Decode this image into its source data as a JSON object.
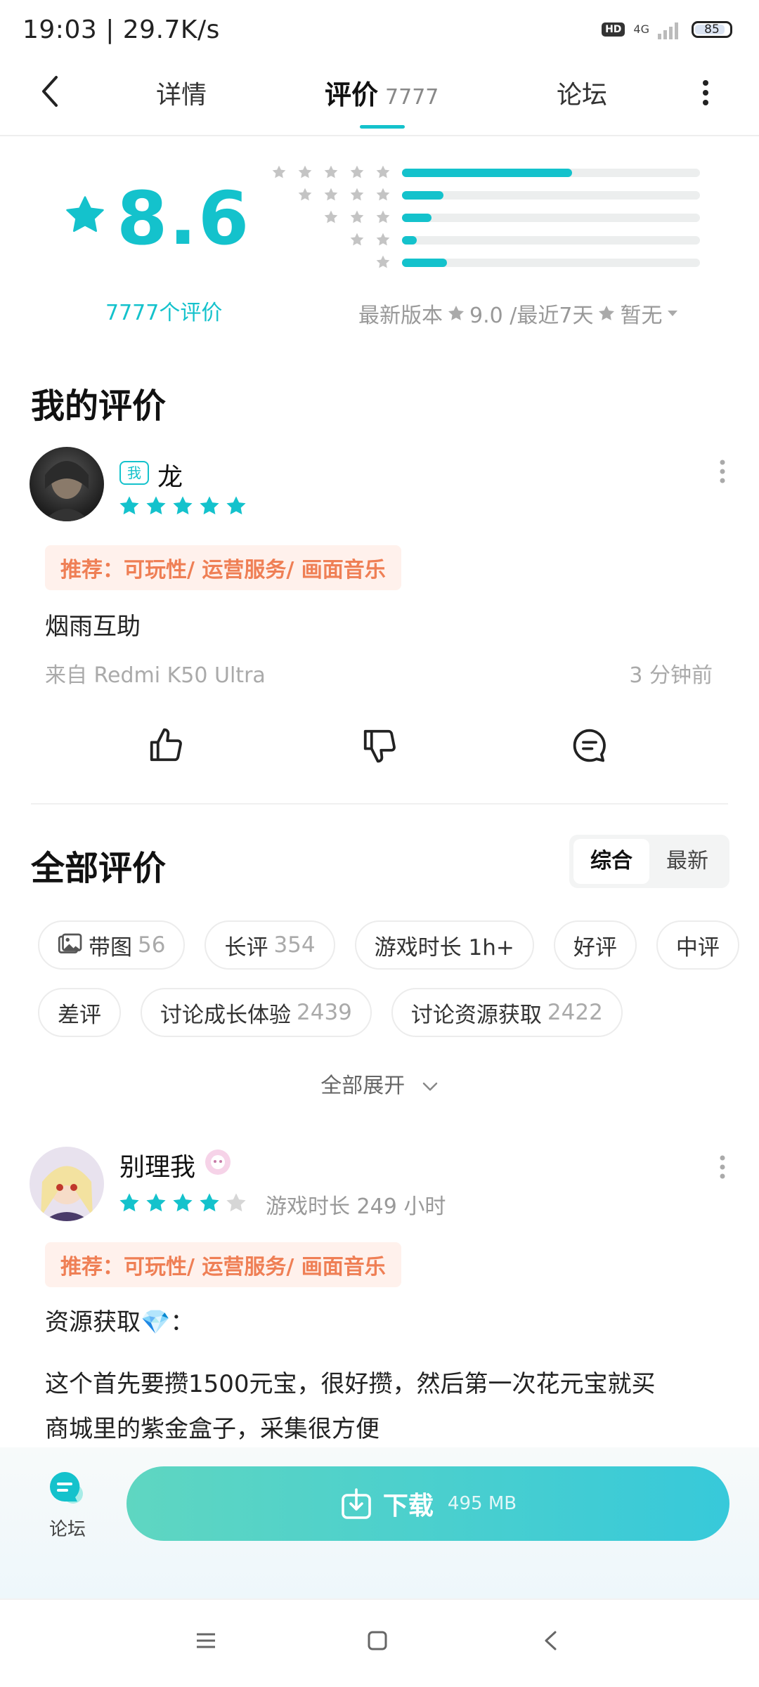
{
  "status_bar": {
    "time": "19:03 | 29.7K/s",
    "hd": "HD",
    "network": "4G",
    "battery": "85"
  },
  "tabs": {
    "details": "详情",
    "reviews": "评价",
    "reviews_count": "7777",
    "forum": "论坛"
  },
  "rating": {
    "score": "8.6",
    "count_text": "7777个评价",
    "distribution": [
      {
        "stars": 5,
        "fraction": 0.57
      },
      {
        "stars": 4,
        "fraction": 0.14
      },
      {
        "stars": 3,
        "fraction": 0.1
      },
      {
        "stars": 2,
        "fraction": 0.05
      },
      {
        "stars": 1,
        "fraction": 0.15
      }
    ],
    "latest_version_label": "最新版本",
    "latest_version_score": "9.0 /最近7天",
    "recent_score": "暂无"
  },
  "my_review": {
    "section_title": "我的评价",
    "me_badge": "我",
    "username": "龙",
    "stars": 5,
    "tag": "推荐：可玩性/ 运营服务/ 画面音乐",
    "content": "烟雨互助",
    "device": "来自 Redmi K50 Ultra",
    "time": "3 分钟前"
  },
  "all_reviews": {
    "section_title": "全部评价",
    "sort_options": [
      "综合",
      "最新"
    ],
    "filters_row1": [
      {
        "label": "带图",
        "count": "56",
        "icon": "image-icon"
      },
      {
        "label": "长评",
        "count": "354"
      },
      {
        "label": "游戏时长 1h+",
        "count": ""
      },
      {
        "label": "好评",
        "count": ""
      },
      {
        "label": "中评",
        "count": ""
      }
    ],
    "filters_row2": [
      {
        "label": "差评",
        "count": ""
      },
      {
        "label": "讨论成长体验",
        "count": "2439"
      },
      {
        "label": "讨论资源获取",
        "count": "2422"
      }
    ],
    "expand_label": "全部展开"
  },
  "review_item": {
    "username": "别理我",
    "stars": 4,
    "playtime": "游戏时长 249 小时",
    "tag": "推荐：可玩性/ 运营服务/ 画面音乐",
    "heading": "资源获取💎：",
    "content_line1": "这个首先要攒1500元宝，很好攒，然后第一次花元宝就买",
    "content_line2": "商城里的紫金盒子，采集很方便"
  },
  "bottom": {
    "forum_label": "论坛",
    "download_label": "下载",
    "download_size": "495 MB"
  },
  "colors": {
    "accent": "#14c2cc",
    "tag_text": "#ef7f55",
    "tag_bg": "#fff1ec"
  }
}
